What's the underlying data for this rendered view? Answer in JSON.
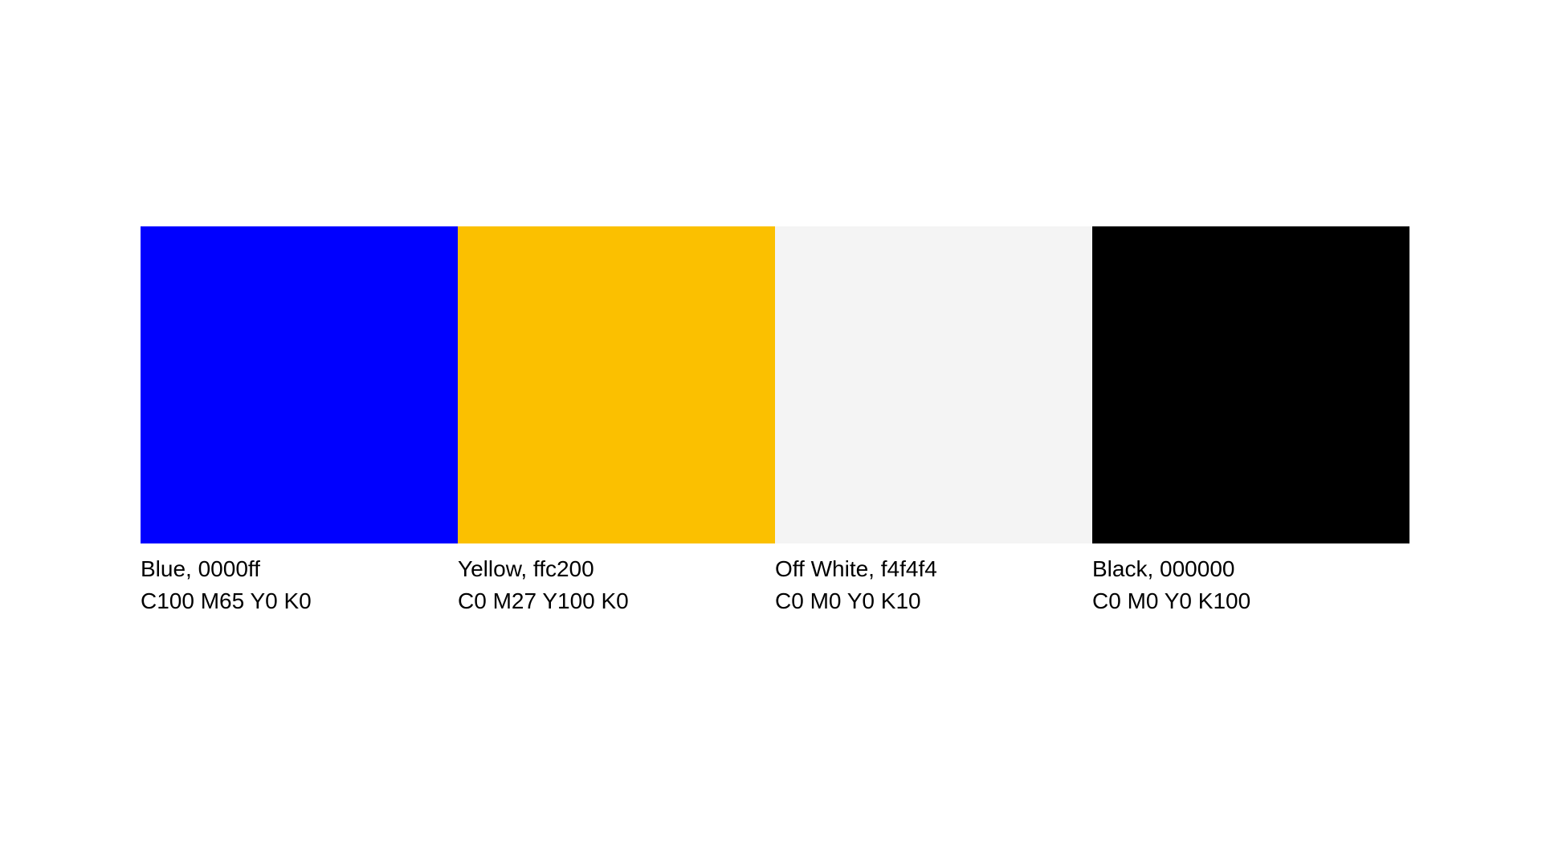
{
  "swatches": [
    {
      "name_line": "Blue, 0000ff",
      "cmyk_line": "C100 M65 Y0 K0",
      "color": "#0000ff"
    },
    {
      "name_line": "Yellow, ffc200",
      "cmyk_line": "C0 M27 Y100 K0",
      "color": "#fbc000"
    },
    {
      "name_line": "Off White, f4f4f4",
      "cmyk_line": "C0 M0 Y0 K10",
      "color": "#f4f4f4"
    },
    {
      "name_line": "Black, 000000",
      "cmyk_line": "C0 M0 Y0 K100",
      "color": "#000000"
    }
  ]
}
